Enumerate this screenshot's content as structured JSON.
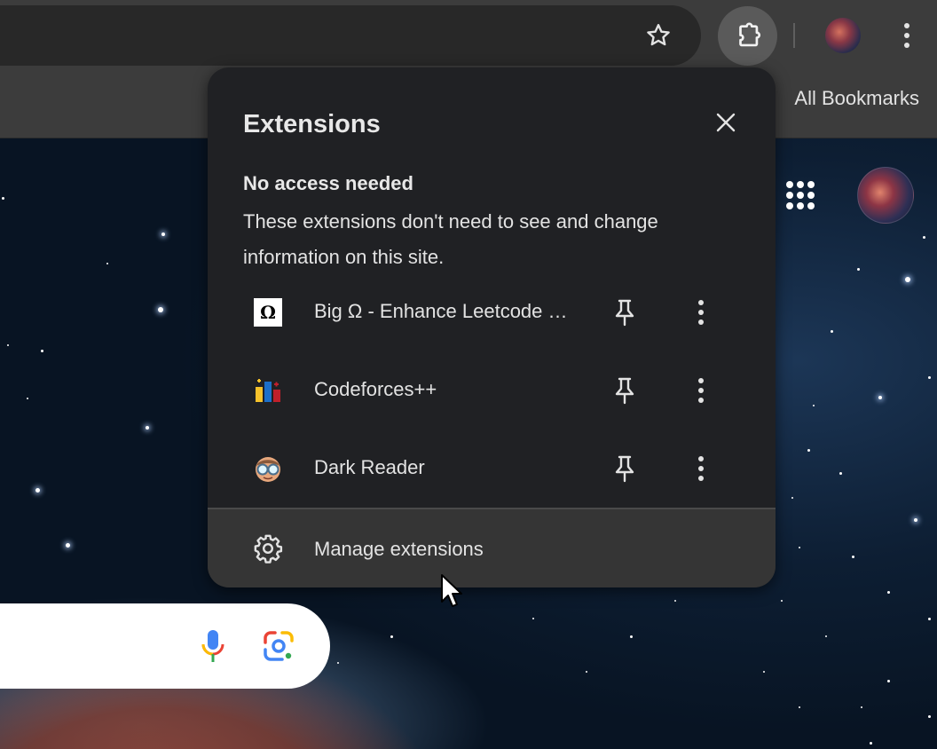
{
  "window": {
    "icons": {
      "bookmark_star": "star-outline-icon",
      "extensions": "puzzle-piece-icon",
      "profile": "profile-avatar",
      "menu": "vertical-dots-icon"
    }
  },
  "bookmarks_bar": {
    "all_bookmarks_label": "All Bookmarks"
  },
  "extensions_popup": {
    "title": "Extensions",
    "close_icon": "close-icon",
    "section": {
      "heading": "No access needed",
      "description": "These extensions don't need to see and change information on this site."
    },
    "extensions": [
      {
        "name": "Big Ω - Enhance Leetcode Experience",
        "icon_text": "Ω",
        "icon": "big-omega-icon"
      },
      {
        "name": "Codeforces++",
        "icon": "codeforces-icon"
      },
      {
        "name": "Dark Reader",
        "icon": "dark-reader-icon"
      }
    ],
    "manage": {
      "label": "Manage extensions",
      "icon": "gear-icon"
    }
  },
  "ntp": {
    "search_box": {
      "mic_icon": "microphone-icon",
      "lens_icon": "google-lens-icon"
    },
    "apps_icon": "apps-grid-icon"
  },
  "colors": {
    "toolbar": "#3c3c3c",
    "omnibox": "#282828",
    "popup_bg": "#202124",
    "popup_footer": "#353535",
    "text": "#e3e3e3"
  }
}
